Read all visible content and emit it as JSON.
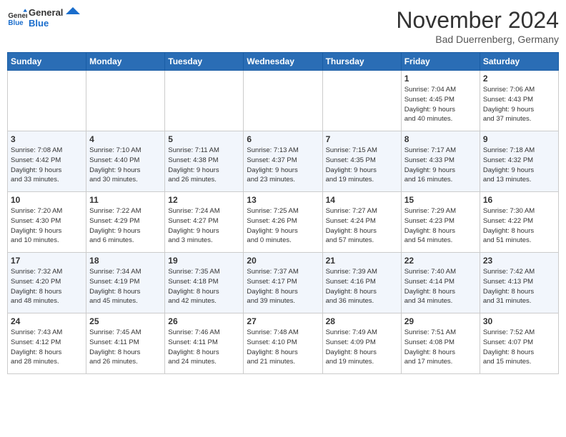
{
  "logo": {
    "text_general": "General",
    "text_blue": "Blue"
  },
  "title": "November 2024",
  "subtitle": "Bad Duerrenberg, Germany",
  "headers": [
    "Sunday",
    "Monday",
    "Tuesday",
    "Wednesday",
    "Thursday",
    "Friday",
    "Saturday"
  ],
  "weeks": [
    [
      {
        "day": "",
        "info": ""
      },
      {
        "day": "",
        "info": ""
      },
      {
        "day": "",
        "info": ""
      },
      {
        "day": "",
        "info": ""
      },
      {
        "day": "",
        "info": ""
      },
      {
        "day": "1",
        "info": "Sunrise: 7:04 AM\nSunset: 4:45 PM\nDaylight: 9 hours\nand 40 minutes."
      },
      {
        "day": "2",
        "info": "Sunrise: 7:06 AM\nSunset: 4:43 PM\nDaylight: 9 hours\nand 37 minutes."
      }
    ],
    [
      {
        "day": "3",
        "info": "Sunrise: 7:08 AM\nSunset: 4:42 PM\nDaylight: 9 hours\nand 33 minutes."
      },
      {
        "day": "4",
        "info": "Sunrise: 7:10 AM\nSunset: 4:40 PM\nDaylight: 9 hours\nand 30 minutes."
      },
      {
        "day": "5",
        "info": "Sunrise: 7:11 AM\nSunset: 4:38 PM\nDaylight: 9 hours\nand 26 minutes."
      },
      {
        "day": "6",
        "info": "Sunrise: 7:13 AM\nSunset: 4:37 PM\nDaylight: 9 hours\nand 23 minutes."
      },
      {
        "day": "7",
        "info": "Sunrise: 7:15 AM\nSunset: 4:35 PM\nDaylight: 9 hours\nand 19 minutes."
      },
      {
        "day": "8",
        "info": "Sunrise: 7:17 AM\nSunset: 4:33 PM\nDaylight: 9 hours\nand 16 minutes."
      },
      {
        "day": "9",
        "info": "Sunrise: 7:18 AM\nSunset: 4:32 PM\nDaylight: 9 hours\nand 13 minutes."
      }
    ],
    [
      {
        "day": "10",
        "info": "Sunrise: 7:20 AM\nSunset: 4:30 PM\nDaylight: 9 hours\nand 10 minutes."
      },
      {
        "day": "11",
        "info": "Sunrise: 7:22 AM\nSunset: 4:29 PM\nDaylight: 9 hours\nand 6 minutes."
      },
      {
        "day": "12",
        "info": "Sunrise: 7:24 AM\nSunset: 4:27 PM\nDaylight: 9 hours\nand 3 minutes."
      },
      {
        "day": "13",
        "info": "Sunrise: 7:25 AM\nSunset: 4:26 PM\nDaylight: 9 hours\nand 0 minutes."
      },
      {
        "day": "14",
        "info": "Sunrise: 7:27 AM\nSunset: 4:24 PM\nDaylight: 8 hours\nand 57 minutes."
      },
      {
        "day": "15",
        "info": "Sunrise: 7:29 AM\nSunset: 4:23 PM\nDaylight: 8 hours\nand 54 minutes."
      },
      {
        "day": "16",
        "info": "Sunrise: 7:30 AM\nSunset: 4:22 PM\nDaylight: 8 hours\nand 51 minutes."
      }
    ],
    [
      {
        "day": "17",
        "info": "Sunrise: 7:32 AM\nSunset: 4:20 PM\nDaylight: 8 hours\nand 48 minutes."
      },
      {
        "day": "18",
        "info": "Sunrise: 7:34 AM\nSunset: 4:19 PM\nDaylight: 8 hours\nand 45 minutes."
      },
      {
        "day": "19",
        "info": "Sunrise: 7:35 AM\nSunset: 4:18 PM\nDaylight: 8 hours\nand 42 minutes."
      },
      {
        "day": "20",
        "info": "Sunrise: 7:37 AM\nSunset: 4:17 PM\nDaylight: 8 hours\nand 39 minutes."
      },
      {
        "day": "21",
        "info": "Sunrise: 7:39 AM\nSunset: 4:16 PM\nDaylight: 8 hours\nand 36 minutes."
      },
      {
        "day": "22",
        "info": "Sunrise: 7:40 AM\nSunset: 4:14 PM\nDaylight: 8 hours\nand 34 minutes."
      },
      {
        "day": "23",
        "info": "Sunrise: 7:42 AM\nSunset: 4:13 PM\nDaylight: 8 hours\nand 31 minutes."
      }
    ],
    [
      {
        "day": "24",
        "info": "Sunrise: 7:43 AM\nSunset: 4:12 PM\nDaylight: 8 hours\nand 28 minutes."
      },
      {
        "day": "25",
        "info": "Sunrise: 7:45 AM\nSunset: 4:11 PM\nDaylight: 8 hours\nand 26 minutes."
      },
      {
        "day": "26",
        "info": "Sunrise: 7:46 AM\nSunset: 4:11 PM\nDaylight: 8 hours\nand 24 minutes."
      },
      {
        "day": "27",
        "info": "Sunrise: 7:48 AM\nSunset: 4:10 PM\nDaylight: 8 hours\nand 21 minutes."
      },
      {
        "day": "28",
        "info": "Sunrise: 7:49 AM\nSunset: 4:09 PM\nDaylight: 8 hours\nand 19 minutes."
      },
      {
        "day": "29",
        "info": "Sunrise: 7:51 AM\nSunset: 4:08 PM\nDaylight: 8 hours\nand 17 minutes."
      },
      {
        "day": "30",
        "info": "Sunrise: 7:52 AM\nSunset: 4:07 PM\nDaylight: 8 hours\nand 15 minutes."
      }
    ]
  ]
}
